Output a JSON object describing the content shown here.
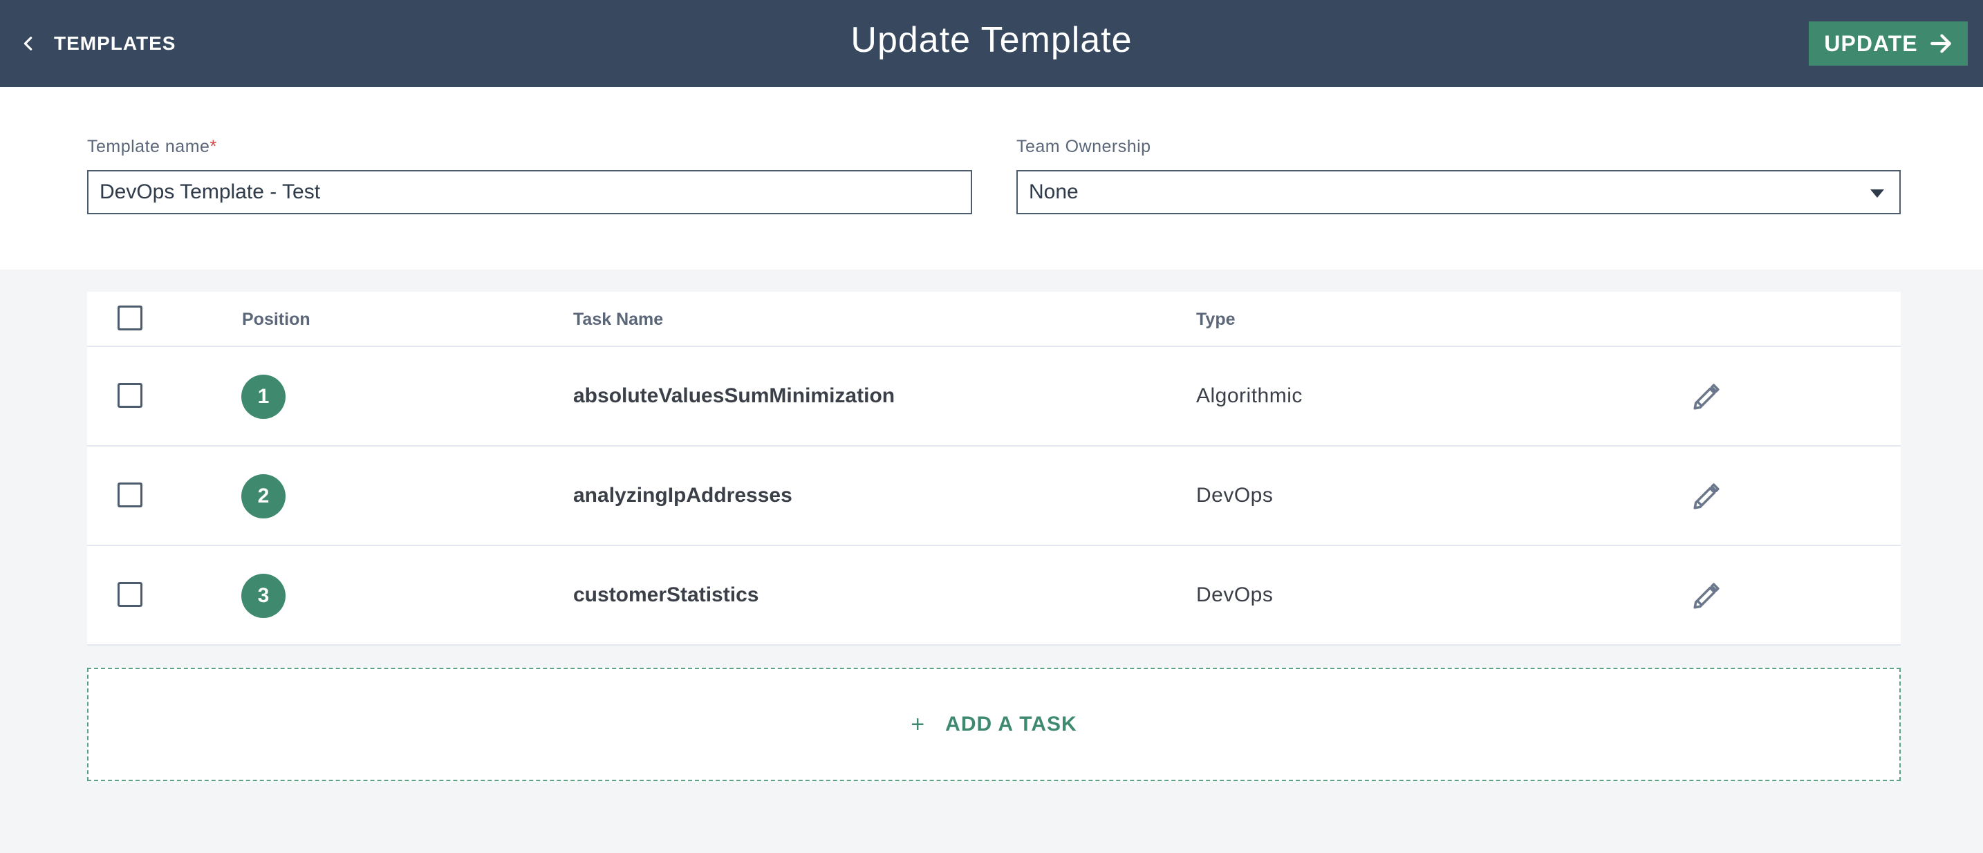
{
  "header": {
    "back_label": "TEMPLATES",
    "title": "Update Template",
    "update_label": "UPDATE"
  },
  "form": {
    "template_name_label": "Template name",
    "required_mark": "*",
    "template_name_value": "DevOps Template - Test",
    "team_ownership_label": "Team Ownership",
    "team_ownership_value": "None"
  },
  "table": {
    "columns": [
      "Position",
      "Task Name",
      "Type"
    ],
    "rows": [
      {
        "position": "1",
        "name": "absoluteValuesSumMinimization",
        "type": "Algorithmic"
      },
      {
        "position": "2",
        "name": "analyzingIpAddresses",
        "type": "DevOps"
      },
      {
        "position": "3",
        "name": "customerStatistics",
        "type": "DevOps"
      }
    ]
  },
  "add_task": {
    "plus": "+",
    "label": "ADD A TASK"
  },
  "colors": {
    "header_bg": "#37485f",
    "accent_green": "#3f8a6f",
    "page_bg": "#f4f5f7"
  },
  "icons": [
    "chevron-left-icon",
    "arrow-right-icon",
    "caret-down-icon",
    "pencil-icon"
  ]
}
